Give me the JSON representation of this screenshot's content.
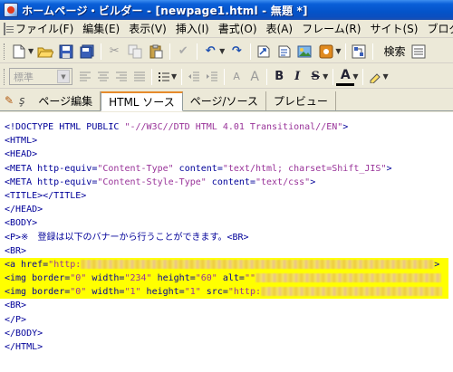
{
  "window": {
    "title": "ホームページ・ビルダー - [newpage1.html - 無題 *]"
  },
  "menu": {
    "items": [
      "ファイル(F)",
      "編集(E)",
      "表示(V)",
      "挿入(I)",
      "書式(O)",
      "表(A)",
      "フレーム(R)",
      "サイト(S)",
      "ブログ(B)"
    ]
  },
  "toolbar1": {
    "search_label": "検索"
  },
  "toolbar2": {
    "style_select_value": "標準",
    "bold_label": "B",
    "italic_label": "I",
    "underline_label": "U",
    "strike_label": "S",
    "color_label": "A"
  },
  "tabs": {
    "items": [
      "ページ編集",
      "HTML ソース",
      "ページ/ソース",
      "プレビュー"
    ],
    "active_index": 1
  },
  "source": {
    "lines": [
      "<!DOCTYPE HTML PUBLIC \"-//W3C//DTD HTML 4.01 Transitional//EN\">",
      "<HTML>",
      "<HEAD>",
      "<META http-equiv=\"Content-Type\" content=\"text/html; charset=Shift_JIS\">",
      "<META http-equiv=\"Content-Style-Type\" content=\"text/css\">",
      "<TITLE></TITLE>",
      "</HEAD>",
      "<BODY>",
      "<P>※　登録は以下のバナーから行うことができます。<BR>",
      "<BR>",
      "<a href=\"http:",
      "<img border=\"0\" width=\"234\" height=\"60\" alt=\"\"",
      "<img border=\"0\" width=\"1\" height=\"1\" src=\"http:",
      "<BR>",
      "</P>",
      "</BODY>",
      "</HTML>"
    ],
    "highlight_color": "#ffff00"
  }
}
